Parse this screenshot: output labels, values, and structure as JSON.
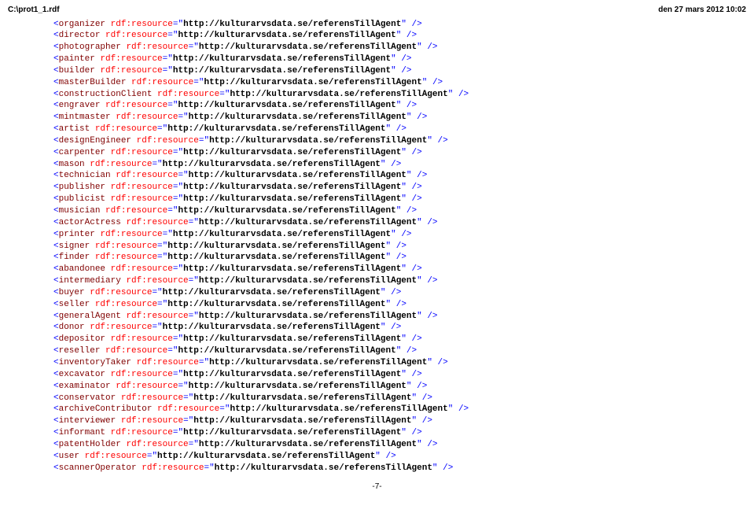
{
  "header": {
    "left": "C:\\prot1_1.rdf",
    "right": "den 27 mars 2012 10:02"
  },
  "attr_name": "rdf:resource",
  "url": "http://kulturarvsdata.se/referensTillAgent",
  "elements": [
    "organizer",
    "director",
    "photographer",
    "painter",
    "builder",
    "masterBuilder",
    "constructionClient",
    "engraver",
    "mintmaster",
    "artist",
    "designEngineer",
    "carpenter",
    "mason",
    "technician",
    "publisher",
    "publicist",
    "musician",
    "actorActress",
    "printer",
    "signer",
    "finder",
    "abandonee",
    "intermediary",
    "buyer",
    "seller",
    "generalAgent",
    "donor",
    "depositor",
    "reseller",
    "inventoryTaker",
    "excavator",
    "examinator",
    "conservator",
    "archiveContributor",
    "interviewer",
    "informant",
    "patentHolder",
    "user",
    "scannerOperator"
  ],
  "footer": "-7-"
}
